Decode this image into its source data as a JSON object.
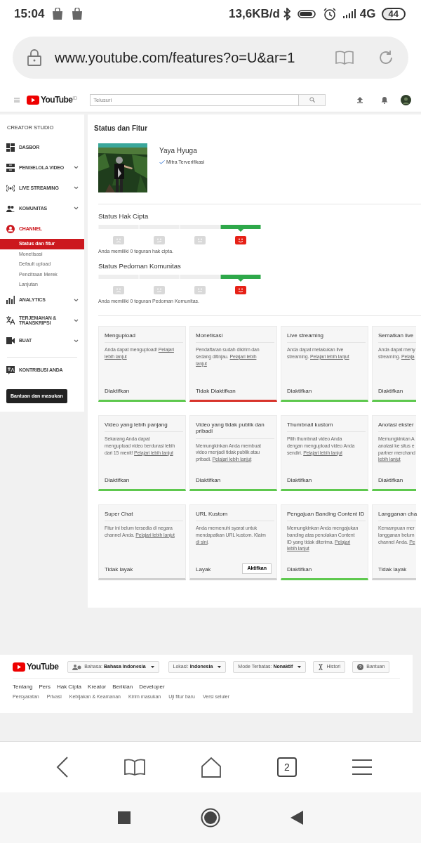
{
  "status_bar": {
    "time": "15:04",
    "speed": "13,6KB/d",
    "network": "4G",
    "battery": "44"
  },
  "browser": {
    "url": "www.youtube.com/features?o=U&ar=1",
    "tab_count": "2"
  },
  "header": {
    "logo": "YouTube",
    "region": "ID",
    "search": {
      "placeholder": "Telusuri"
    }
  },
  "sidebar": {
    "title": "CREATOR STUDIO",
    "items": [
      {
        "label": "DASBOR",
        "expandable": false,
        "selected": false
      },
      {
        "label": "PENGELOLA VIDEO",
        "expandable": true,
        "selected": false
      },
      {
        "label": "LIVE STREAMING",
        "expandable": true,
        "selected": false
      },
      {
        "label": "KOMUNITAS",
        "expandable": true,
        "selected": false
      },
      {
        "label": "CHANNEL",
        "expandable": false,
        "selected": true,
        "children": [
          {
            "label": "Status dan fitur",
            "selected": true
          },
          {
            "label": "Monetisasi",
            "selected": false
          },
          {
            "label": "Default upload",
            "selected": false
          },
          {
            "label": "Pencitraan Merek",
            "selected": false
          },
          {
            "label": "Lanjutan",
            "selected": false
          }
        ]
      },
      {
        "label": "ANALYTICS",
        "expandable": true,
        "selected": false
      },
      {
        "label": "TERJEMAHAN & TRANSKRIPSI",
        "expandable": true,
        "selected": false
      },
      {
        "label": "BUAT",
        "expandable": true,
        "selected": false
      }
    ],
    "extra_items": [
      {
        "label": "KONTRIBUSI ANDA"
      }
    ],
    "help_button": "Bantuan dan masukan"
  },
  "main": {
    "title": "Status dan Fitur",
    "channel": {
      "name": "Yaya Hyuga",
      "badge": "Mitra Terverifikasi"
    },
    "strike_sections": [
      {
        "title": "Status Hak Cipta",
        "segments": [
          {
            "kind": "sad",
            "selected": false
          },
          {
            "kind": "wry",
            "selected": false
          },
          {
            "kind": "neutral",
            "selected": false
          },
          {
            "kind": "happy",
            "selected": true
          }
        ],
        "note": "Anda memiliki 0 teguran hak cipta."
      },
      {
        "title": "Status Pedoman Komunitas",
        "segments": [
          {
            "kind": "sad",
            "selected": false
          },
          {
            "kind": "wry",
            "selected": false
          },
          {
            "kind": "neutral",
            "selected": false
          },
          {
            "kind": "happy",
            "selected": true
          }
        ],
        "note": "Anda memiliki 0 teguran Pedoman Komunitas."
      }
    ],
    "features": [
      {
        "title": "Mengupload",
        "lines": [
          {
            "text": "Anda dapat mengupload!",
            "link": "Pelajari"
          },
          {
            "link": "lebih lanjut"
          }
        ],
        "status": "Diaktifkan",
        "kind": "enabled"
      },
      {
        "title": "Monetisasi",
        "lines": [
          {
            "text": "Pendaftaran sudah dikirim dan"
          },
          {
            "text": "sedang ditinjau.",
            "link": "Pelajari lebih"
          },
          {
            "link": "lanjut"
          }
        ],
        "status": "Tidak Diaktifkan",
        "kind": "disabled"
      },
      {
        "title": "Live streaming",
        "lines": [
          {
            "text": "Anda dapat melakukan live"
          },
          {
            "text": "streaming.",
            "link": "Pelajari lebih lanjut"
          }
        ],
        "status": "Diaktifkan",
        "kind": "enabled"
      },
      {
        "title": "Sematkan live",
        "lines": [
          {
            "text": "Anda dapat meny"
          },
          {
            "text": "streaming.",
            "link": "Pelaja"
          }
        ],
        "status": "Diaktifkan",
        "kind": "enabled"
      },
      {
        "title": "Video yang lebih panjang",
        "lines": [
          {
            "text": "Sekarang Anda dapat"
          },
          {
            "text": "mengupload video berdurasi lebih"
          },
          {
            "text": "dari 15 menit!",
            "link": "Pelajari lebih lanjut"
          }
        ],
        "status": "Diaktifkan",
        "kind": "enabled"
      },
      {
        "title": "Video yang tidak publik dan pribadi",
        "lines": [
          {
            "text": "Memungkinkan Anda membuat"
          },
          {
            "text": "video menjadi tidak publik atau"
          },
          {
            "text": "pribadi.",
            "link": "Pelajari lebih lanjut"
          }
        ],
        "status": "Diaktifkan",
        "kind": "enabled"
      },
      {
        "title": "Thumbnail kustom",
        "lines": [
          {
            "text": "Pilih thumbnail video Anda"
          },
          {
            "text": "dengan mengupload video Anda"
          },
          {
            "text": "sendiri.",
            "link": "Pelajari lebih lanjut"
          }
        ],
        "status": "Diaktifkan",
        "kind": "enabled"
      },
      {
        "title": "Anotasi ekster",
        "lines": [
          {
            "text": "Memungkinkan A"
          },
          {
            "text": "anotasi ke situs e"
          },
          {
            "text": "partner merchand"
          },
          {
            "link": "lebih lanjut"
          }
        ],
        "status": "Diaktifkan",
        "kind": "enabled"
      },
      {
        "title": "Super Chat",
        "lines": [
          {
            "text": "Fitur ini belum tersedia di negara"
          },
          {
            "text": "channel Anda.",
            "link": "Pelajari lebih lanjut"
          }
        ],
        "status": "Tidak layak",
        "kind": "ineligible"
      },
      {
        "title": "URL Kustom",
        "lines": [
          {
            "text": "Anda memenuhi syarat untuk"
          },
          {
            "text": "mendapatkan URL kustom. Klaim"
          },
          {
            "link": "di sini",
            "after": "."
          }
        ],
        "status": "Layak",
        "kind": "available",
        "action": "Aktifkan"
      },
      {
        "title": "Pengajuan Banding Content ID",
        "lines": [
          {
            "text": "Memungkinkan Anda mengajukan"
          },
          {
            "text": "banding atas penolakan Content"
          },
          {
            "text": "ID yang tidak diterima.",
            "link": "Pelajari"
          },
          {
            "link": "lebih lanjut"
          }
        ],
        "status": "Diaktifkan",
        "kind": "enabled"
      },
      {
        "title": "Langganan cha",
        "lines": [
          {
            "text": "Kemampuan mer"
          },
          {
            "text": "langganan belum"
          },
          {
            "text": "channel Anda.",
            "link": "Pe"
          }
        ],
        "status": "Tidak layak",
        "kind": "ineligible"
      }
    ]
  },
  "footer": {
    "logo": "YouTube",
    "buttons": [
      {
        "label": "Bahasa: **Bahasa Indonesia**",
        "dropdown": true
      },
      {
        "label": "Lokasi: **Indonesia**",
        "dropdown": true
      },
      {
        "label": "Mode Terbatas: **Nonaktif**",
        "dropdown": true
      },
      {
        "label": "Histori",
        "dropdown": false
      },
      {
        "label": "Bantuan",
        "dropdown": false
      }
    ],
    "links": [
      "Tentang",
      "Pers",
      "Hak Cipta",
      "Kreator",
      "Beriklan",
      "Developer"
    ],
    "small_links": [
      "Persyaratan",
      "Privasi",
      "Kebijakan & Keamanan",
      "Kirim masukan",
      "Uji fitur baru",
      "Versi seluler"
    ]
  }
}
